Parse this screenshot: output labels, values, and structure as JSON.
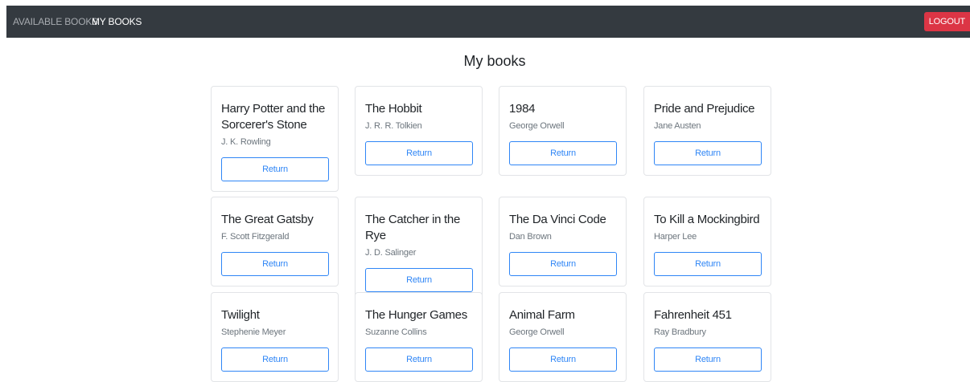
{
  "nav": {
    "available_label": "AVAILABLE BOOKS",
    "my_books_label": "MY BOOKS",
    "logout_label": "LOGOUT"
  },
  "page": {
    "title": "My books"
  },
  "colors": {
    "navbar": "#343a40",
    "logout": "#dc3545",
    "accent": "#2f86f6"
  },
  "books": [
    {
      "title": "Harry Potter and the Sorcerer's Stone",
      "author": "J. K. Rowling",
      "action": "Return"
    },
    {
      "title": "The Hobbit",
      "author": "J. R. R. Tolkien",
      "action": "Return"
    },
    {
      "title": "1984",
      "author": "George Orwell",
      "action": "Return"
    },
    {
      "title": "Pride and Prejudice",
      "author": "Jane Austen",
      "action": "Return"
    },
    {
      "title": "The Great Gatsby",
      "author": "F. Scott Fitzgerald",
      "action": "Return"
    },
    {
      "title": "The Catcher in the Rye",
      "author": "J. D. Salinger",
      "action": "Return"
    },
    {
      "title": "The Da Vinci Code",
      "author": "Dan Brown",
      "action": "Return"
    },
    {
      "title": "To Kill a Mockingbird",
      "author": "Harper Lee",
      "action": "Return"
    },
    {
      "title": "Twilight",
      "author": "Stephenie Meyer",
      "action": "Return"
    },
    {
      "title": "The Hunger Games",
      "author": "Suzanne Collins",
      "action": "Return"
    },
    {
      "title": "Animal Farm",
      "author": "George Orwell",
      "action": "Return"
    },
    {
      "title": "Fahrenheit 451",
      "author": "Ray Bradbury",
      "action": "Return"
    }
  ]
}
